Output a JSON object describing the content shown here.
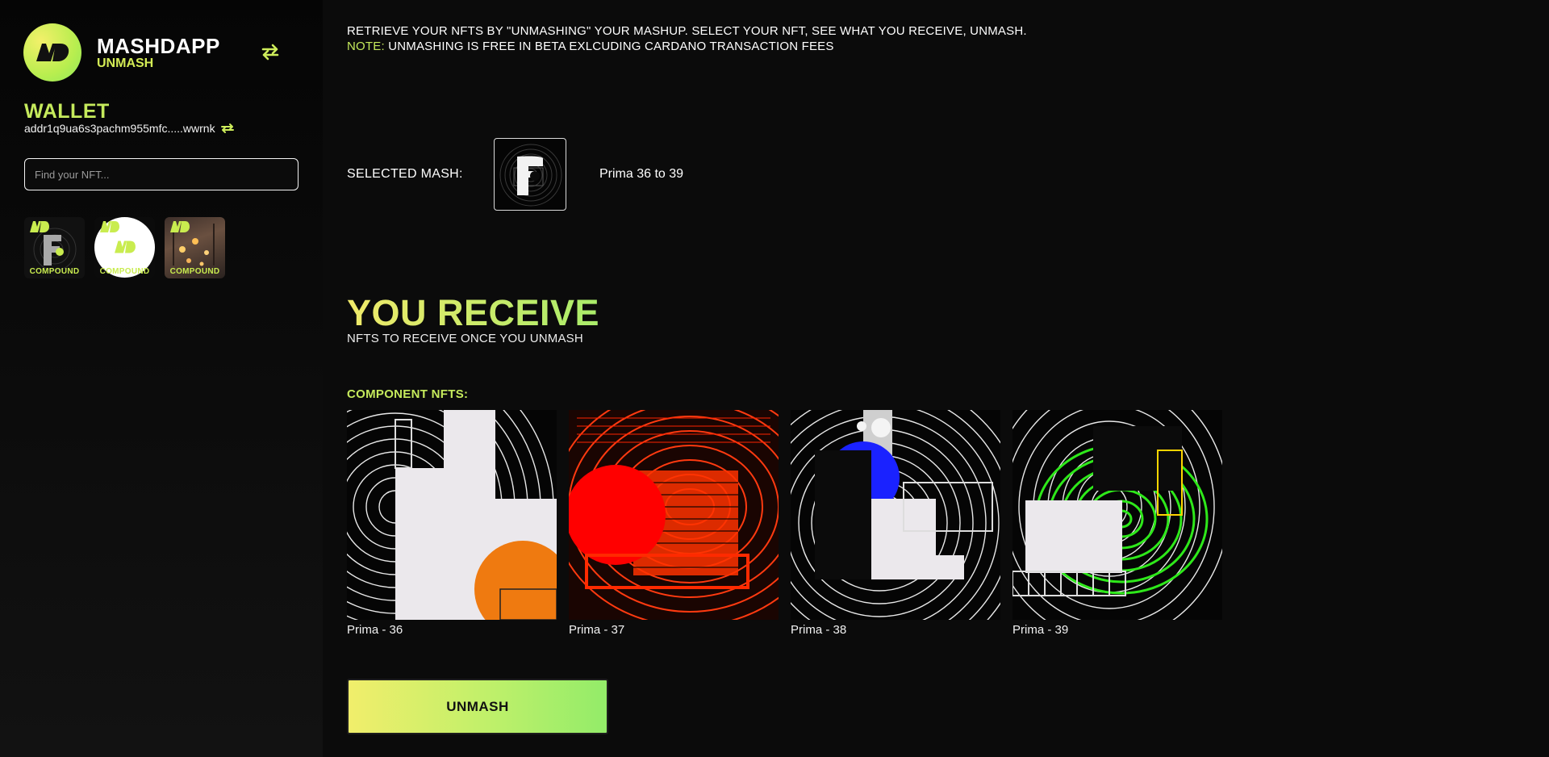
{
  "brand": {
    "title": "MASHDAPP",
    "subtitle": "UNMASH",
    "accent_color": "#c5ea5c"
  },
  "sidebar": {
    "wallet_title": "WALLET",
    "wallet_address": "addr1q9ua6s3pachm955mfc.....wwrnk",
    "search_placeholder": "Find your NFT...",
    "nfts": [
      {
        "badge": "COMPOUND",
        "icon": "f-logo-nft"
      },
      {
        "badge": "COMPOUND",
        "icon": "white-circle-nft"
      },
      {
        "badge": "COMPOUND",
        "icon": "lanterns-nft"
      }
    ]
  },
  "main": {
    "intro_line": "RETRIEVE YOUR NFTS BY \"UNMASHING\" YOUR MASHUP. SELECT YOUR NFT, SEE WHAT YOU RECEIVE, UNMASH.",
    "note_key": "NOTE:",
    "note_text": " UNMASHING IS FREE IN BETA EXLCUDING CARDANO TRANSACTION FEES",
    "selected_label": "SELECTED MASH:",
    "selected_name": "Prima 36 to 39",
    "receive_title": "YOU RECEIVE",
    "receive_subtitle": "NFTS TO RECEIVE ONCE YOU UNMASH",
    "component_label": "COMPONENT NFTS:",
    "components": [
      {
        "name": "Prima - 36",
        "accent": "#ef7a10"
      },
      {
        "name": "Prima - 37",
        "accent": "#ff1a00"
      },
      {
        "name": "Prima - 38",
        "accent": "#1a22ff"
      },
      {
        "name": "Prima - 39",
        "accent": "#2ee81a"
      }
    ],
    "unmash_label": "UNMASH"
  }
}
